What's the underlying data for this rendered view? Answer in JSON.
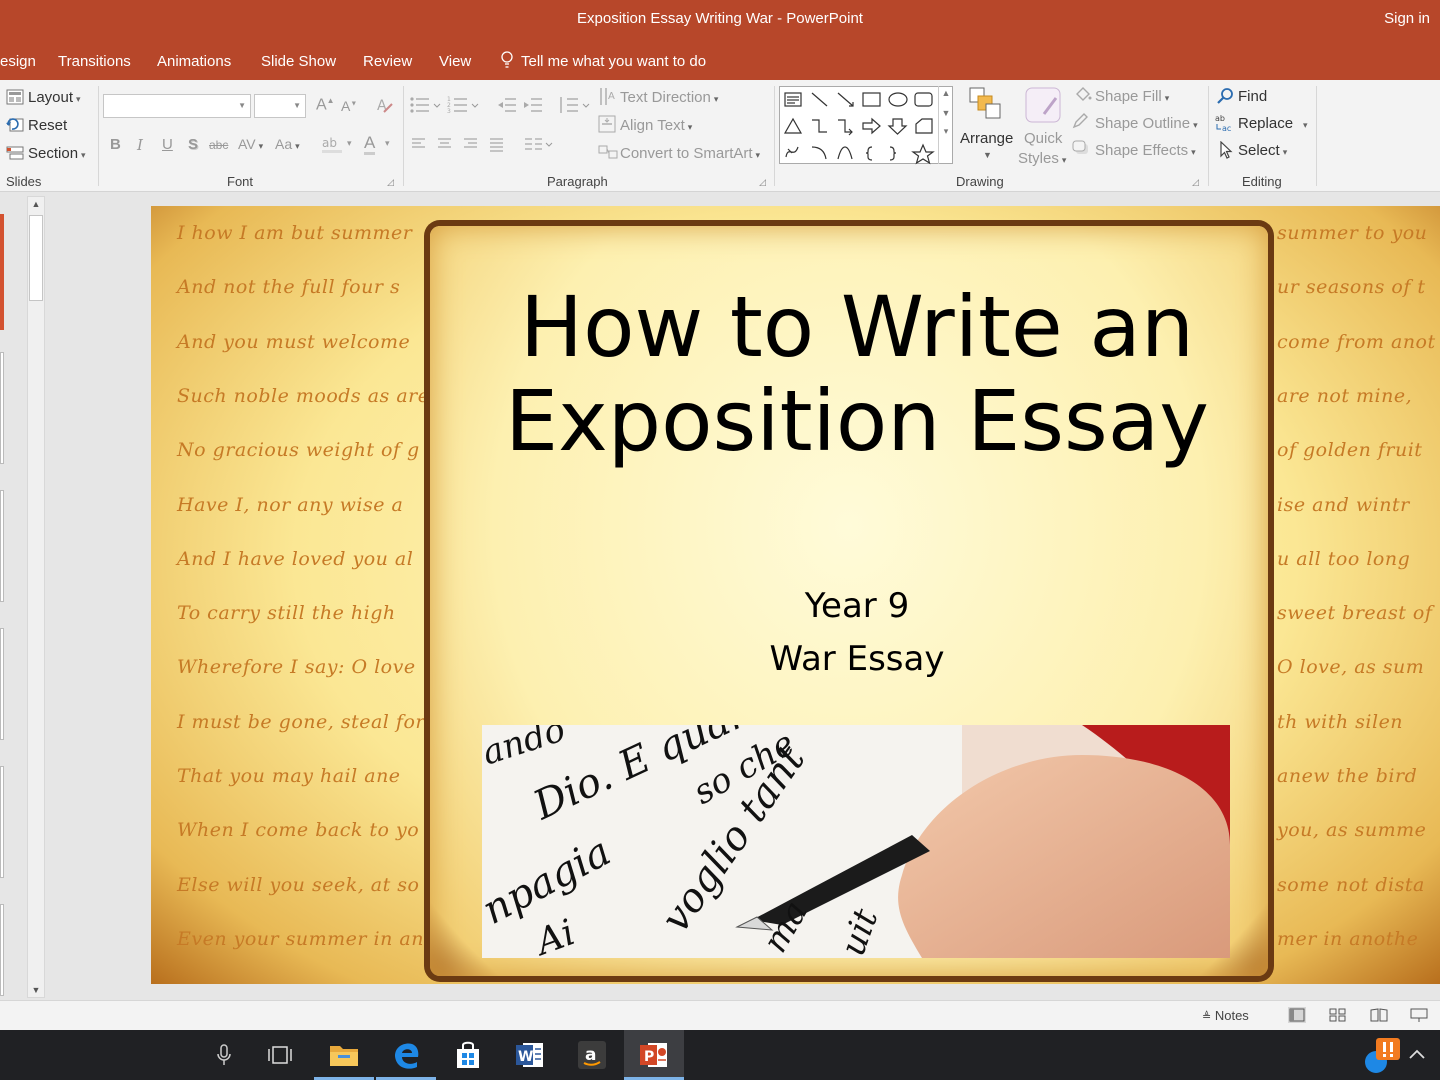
{
  "window": {
    "title": "Exposition Essay Writing War  -  PowerPoint",
    "sign_in": "Sign in"
  },
  "tabs": [
    {
      "label": "esign"
    },
    {
      "label": "Transitions"
    },
    {
      "label": "Animations"
    },
    {
      "label": "Slide Show"
    },
    {
      "label": "Review"
    },
    {
      "label": "View"
    }
  ],
  "tell_me": {
    "label": "Tell me what you want to do"
  },
  "ribbon": {
    "slides": {
      "group_label": "Slides",
      "layout": "Layout",
      "reset": "Reset",
      "section": "Section"
    },
    "font": {
      "group_label": "Font",
      "font_name": "",
      "font_size": "",
      "bold": "B",
      "italic": "I",
      "underline": "U",
      "shadow": "S",
      "strike": "abc",
      "spacing": "AV",
      "case": "Aa",
      "grow": "A",
      "shrink": "A",
      "color": "A"
    },
    "paragraph": {
      "group_label": "Paragraph",
      "text_direction": "Text Direction",
      "align_text": "Align Text",
      "convert_smartart": "Convert to SmartArt"
    },
    "drawing": {
      "group_label": "Drawing",
      "arrange": "Arrange",
      "quick_styles_1": "Quick",
      "quick_styles_2": "Styles",
      "shape_fill": "Shape Fill",
      "shape_outline": "Shape Outline",
      "shape_effects": "Shape Effects"
    },
    "editing": {
      "group_label": "Editing",
      "find": "Find",
      "replace": "Replace",
      "select": "Select"
    }
  },
  "slide": {
    "title_line1": "How to Write an",
    "title_line2": "Exposition Essay",
    "subtitle_line1": "Year 9",
    "subtitle_line2": "War Essay",
    "left_scroll_lines": [
      "I how I am but summer",
      "And not the full four s",
      "And you must welcome",
      "Such noble moods as are",
      "No gracious weight of g",
      "Have I, nor any wise a",
      "And I have loved you al",
      "To carry still the high",
      "Wherefore I say: O love",
      "I must be gone, steal for",
      "That you may hail ane",
      "When I come back to yo",
      "Else will you seek, at so",
      "Even your summer in an"
    ],
    "right_scroll_lines": [
      "summer to you",
      "ur seasons of t",
      "come from anot",
      "are not mine,",
      "of golden fruit",
      "ise and wintr",
      "u all too long",
      "sweet breast of",
      "O love, as sum",
      "th with silen",
      "anew the bird",
      "you, as summe",
      "some not dista",
      "mer in anothe"
    ],
    "photo_script": [
      "ando",
      "Dio. E quan",
      "so  che",
      "npagia",
      "voglio  tant",
      "Ai",
      "ma",
      "uit"
    ]
  },
  "status": {
    "notes": "Notes"
  },
  "colors": {
    "accent": "#b7472a",
    "taskbar": "#202124"
  }
}
